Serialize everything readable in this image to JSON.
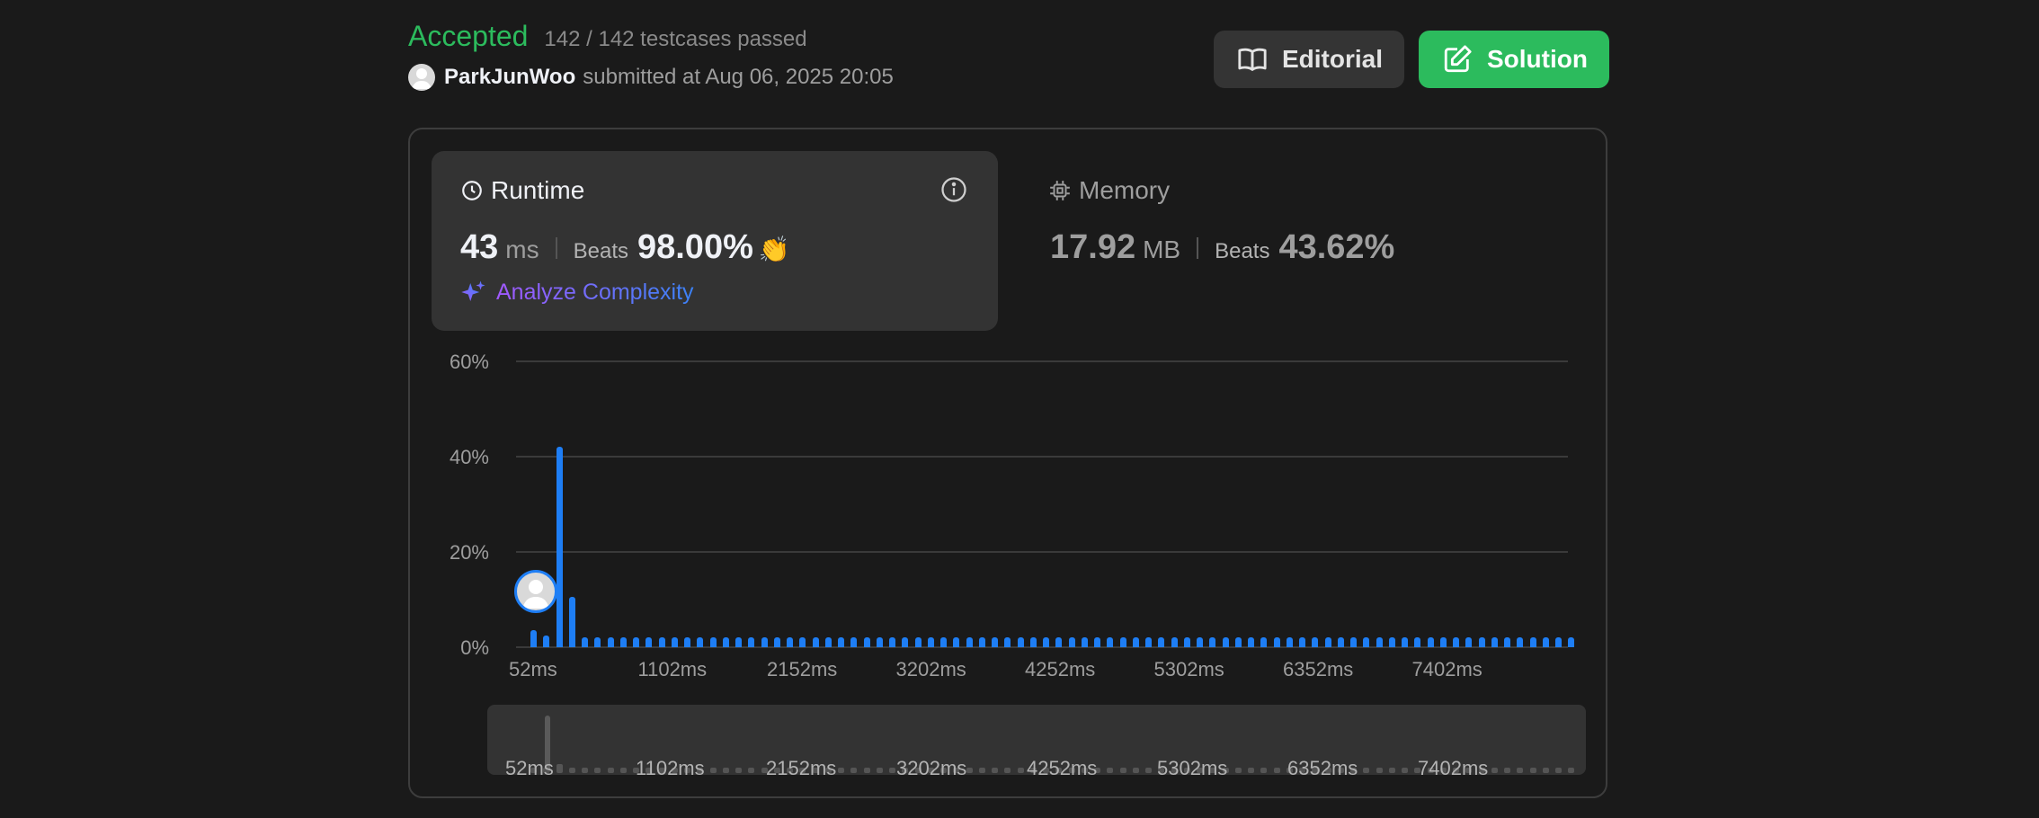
{
  "header": {
    "status": "Accepted",
    "testcases": "142 / 142 testcases passed",
    "username": "ParkJunWoo",
    "submitted_text": "submitted at Aug 06, 2025 20:05"
  },
  "buttons": {
    "editorial": "Editorial",
    "solution": "Solution"
  },
  "runtime": {
    "title": "Runtime",
    "value": "43",
    "unit": "ms",
    "beats_label": "Beats",
    "beats_value": "98.00%",
    "analyze_label": "Analyze Complexity"
  },
  "memory": {
    "title": "Memory",
    "value": "17.92",
    "unit": "MB",
    "beats_label": "Beats",
    "beats_value": "43.62%"
  },
  "colors": {
    "accent_green": "#2cbb5d",
    "bar_blue": "#1e7ef5",
    "panel_bg": "#333333",
    "page_bg": "#1a1a1a"
  },
  "icons": [
    "user-avatar-icon",
    "book-icon",
    "edit-icon",
    "clock-icon",
    "info-icon",
    "clap-icon",
    "sparkle-icon",
    "chip-icon"
  ],
  "chart_data": {
    "type": "bar",
    "title": "",
    "xlabel": "",
    "ylabel": "",
    "ylim": [
      0,
      60
    ],
    "yticks": [
      "60%",
      "40%",
      "20%",
      "0%"
    ],
    "xticks": [
      "52ms",
      "1102ms",
      "2152ms",
      "3202ms",
      "4252ms",
      "5302ms",
      "6352ms",
      "7402ms"
    ],
    "values": [
      3.5,
      2.5,
      42,
      10.5,
      2,
      2,
      2,
      2,
      2,
      2,
      2,
      2,
      2,
      2,
      2,
      2,
      2,
      2,
      2,
      2,
      2,
      2,
      2,
      2,
      2,
      2,
      2,
      2,
      2,
      2,
      2,
      2,
      2,
      2,
      2,
      2,
      2,
      2,
      2,
      2,
      2,
      2,
      2,
      2,
      2,
      2,
      2,
      2,
      2,
      2,
      2,
      2,
      2,
      2,
      2,
      2,
      2,
      2,
      2,
      2,
      2,
      2,
      2,
      2,
      2,
      2,
      2,
      2,
      2,
      2,
      2,
      2,
      2,
      2,
      2,
      2,
      2,
      2,
      2,
      2,
      2,
      2
    ],
    "grid": true
  }
}
